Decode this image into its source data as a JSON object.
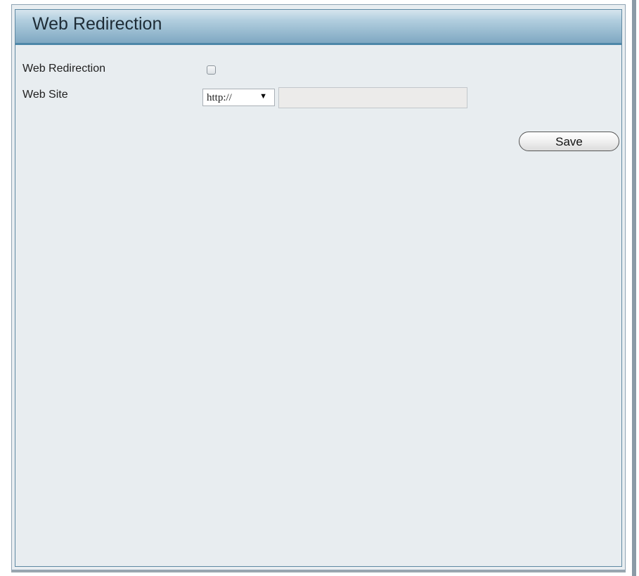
{
  "header": {
    "title": "Web Redirection"
  },
  "form": {
    "web_redirection": {
      "label": "Web Redirection",
      "checked": false
    },
    "web_site": {
      "label": "Web Site",
      "protocol_selected": "http://",
      "url_value": "",
      "url_placeholder": ""
    }
  },
  "actions": {
    "save_label": "Save"
  },
  "colors": {
    "header_gradient_top": "#d6e5ee",
    "header_gradient_bottom": "#7fa8c2",
    "header_rule": "#4d87a9",
    "panel_background": "#e8edf0"
  },
  "icons": {
    "protocol_dropdown": "triangle-down-icon"
  }
}
